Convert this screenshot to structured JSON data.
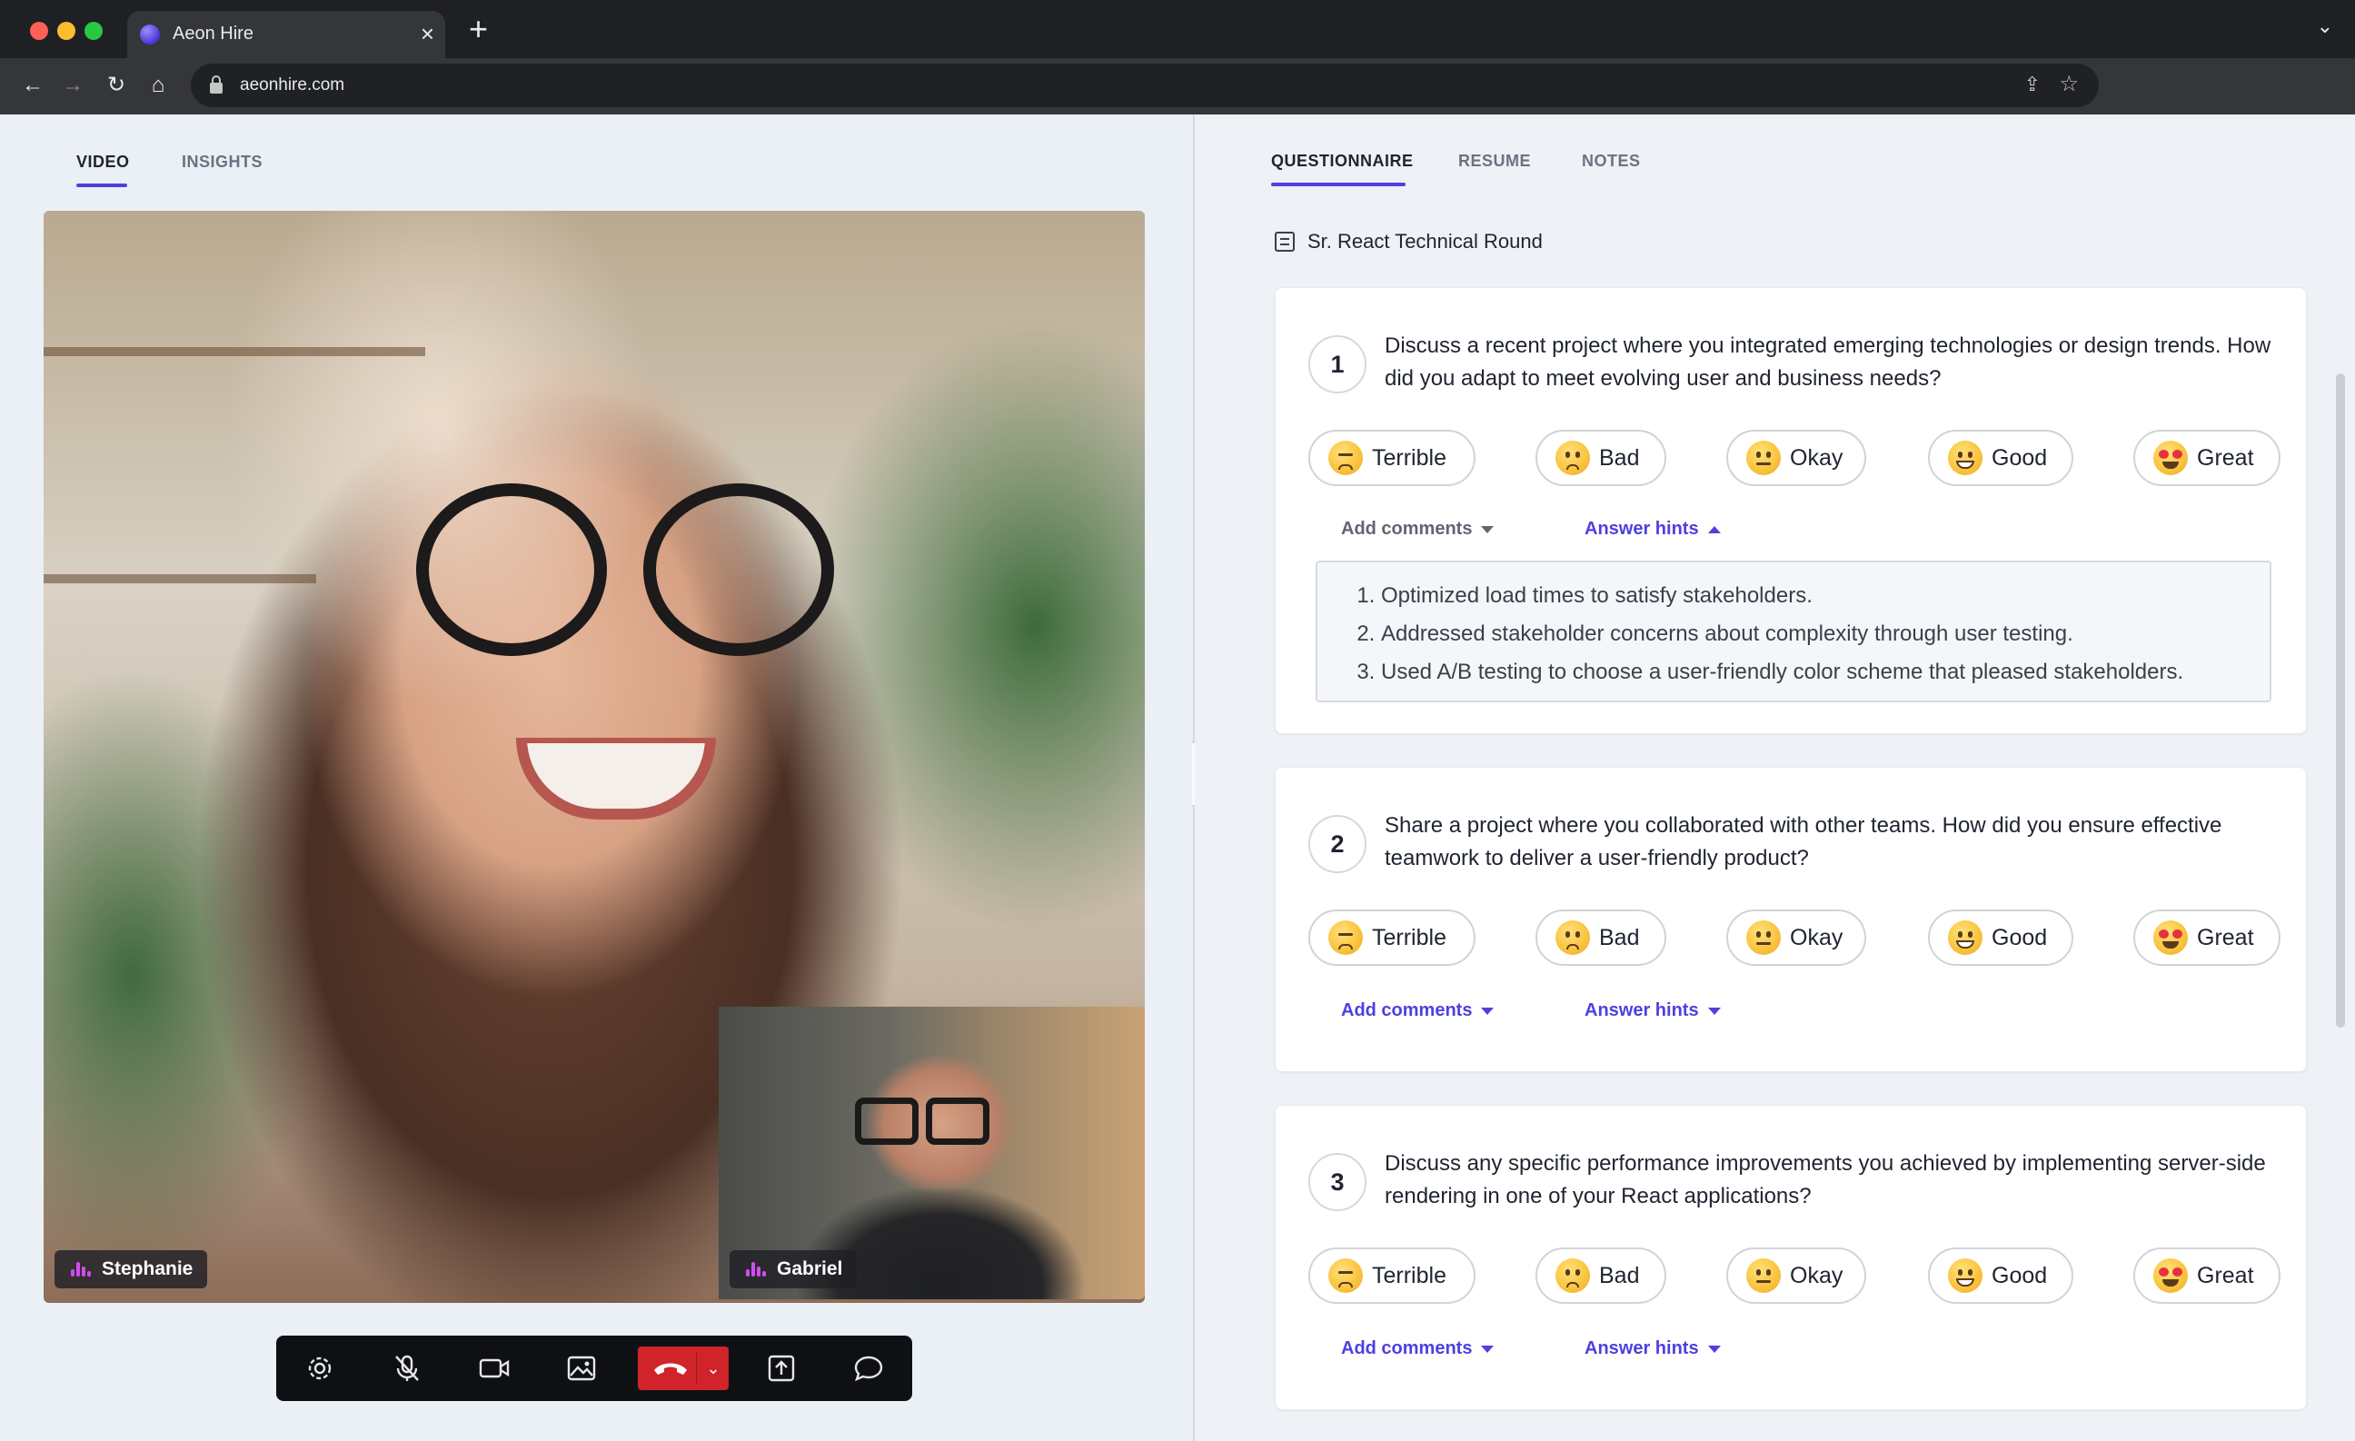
{
  "browser": {
    "tab_title": "Aeon Hire",
    "tab_close": "×",
    "new_tab": "+",
    "url": "aeonhire.com"
  },
  "left_tabs": [
    {
      "label": "VIDEO",
      "active": true
    },
    {
      "label": "INSIGHTS",
      "active": false
    }
  ],
  "right_tabs": [
    {
      "label": "QUESTIONNAIRE",
      "active": true
    },
    {
      "label": "RESUME",
      "active": false
    },
    {
      "label": "NOTES",
      "active": false
    }
  ],
  "participants": {
    "main": "Stephanie",
    "pip": "Gabriel"
  },
  "call_controls": [
    "settings-icon",
    "mic-off-icon",
    "camera-icon",
    "background-image-icon",
    "end-call-icon",
    "share-screen-icon",
    "chat-icon"
  ],
  "questionnaire": {
    "title": "Sr. React Technical Round",
    "rating_labels": [
      "Terrible",
      "Bad",
      "Okay",
      "Good",
      "Great"
    ],
    "add_comments": "Add comments",
    "answer_hints": "Answer hints",
    "questions": [
      {
        "number": "1",
        "text": "Discuss a recent project where you integrated emerging technologies or design trends. How did you adapt to meet evolving user and business needs?",
        "hints_open": true,
        "hints": [
          "Optimized load times to satisfy stakeholders.",
          "Addressed stakeholder concerns about complexity through user testing.",
          "Used A/B testing to choose a user-friendly color scheme that pleased stakeholders."
        ]
      },
      {
        "number": "2",
        "text": "Share a project where you collaborated with other teams. How did you ensure effective teamwork to deliver a user-friendly product?",
        "hints_open": false
      },
      {
        "number": "3",
        "text": "Discuss any specific performance improvements you achieved by implementing server-side rendering in one of your React applications?",
        "hints_open": false
      }
    ]
  },
  "colors": {
    "accent": "#4f3fe0",
    "end_call": "#d0242a",
    "speaking_indicator": "#d14cf0"
  }
}
